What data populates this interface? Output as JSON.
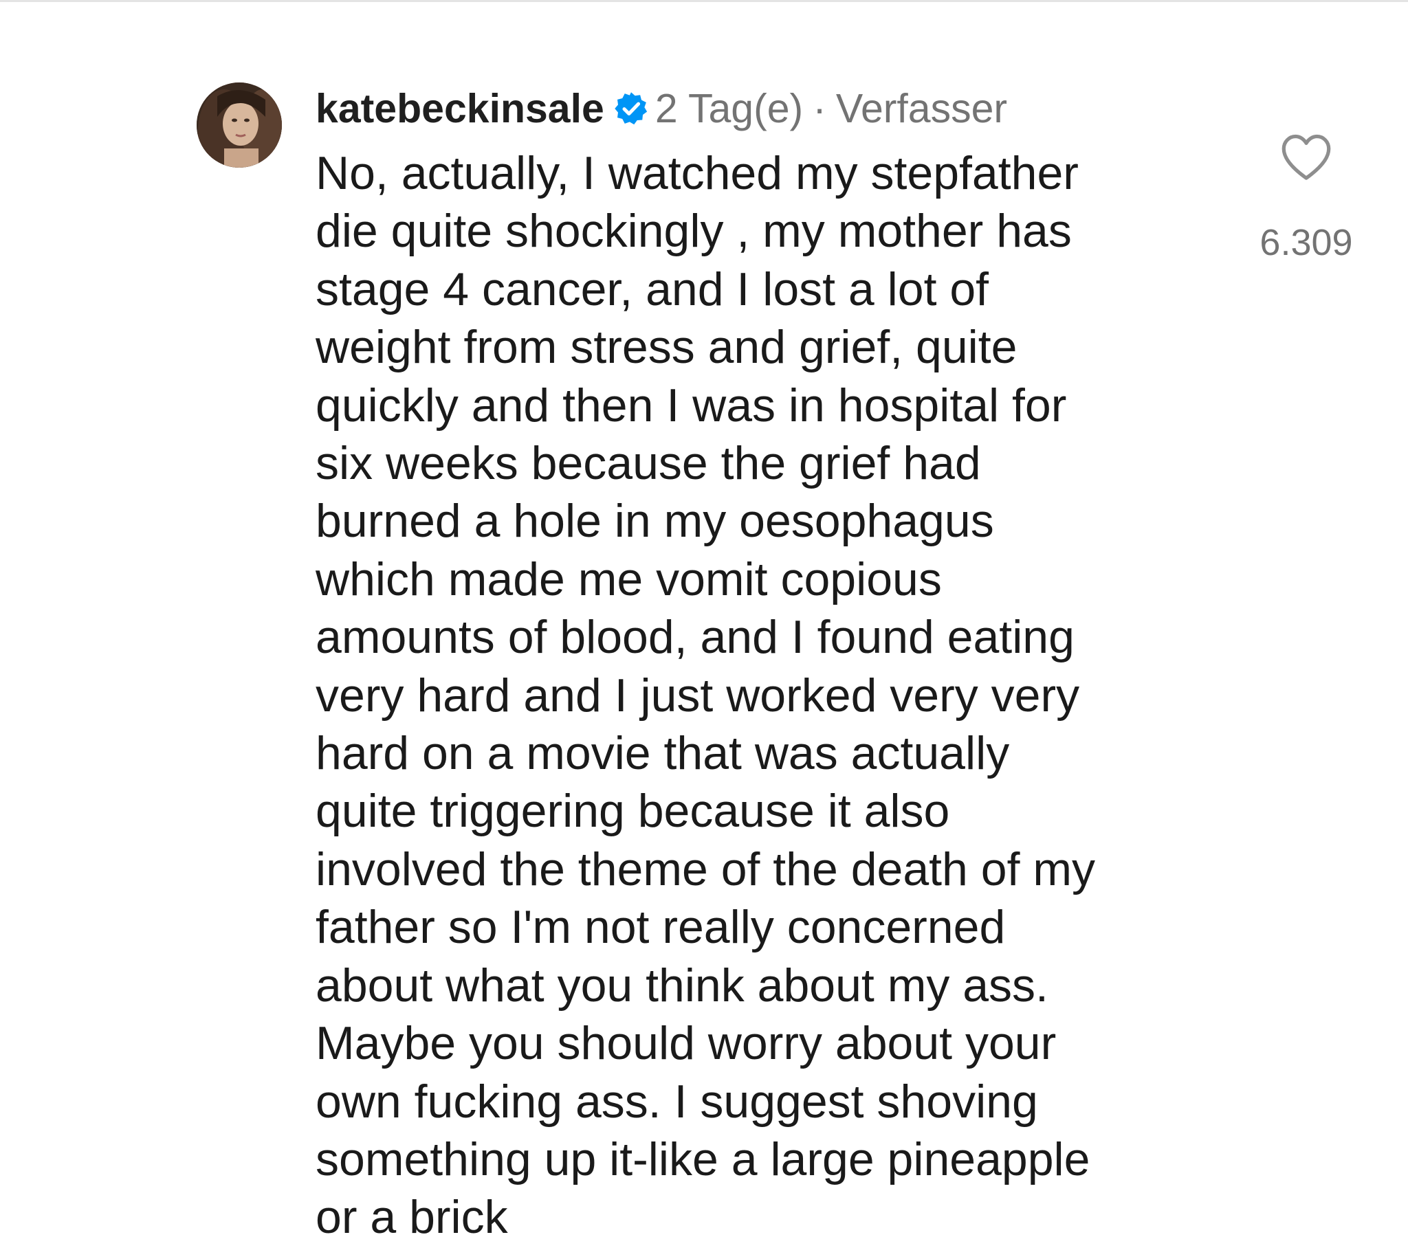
{
  "comment": {
    "username": "katebeckinsale",
    "verified": true,
    "time_ago": "2 Tag(e)",
    "separator": "·",
    "role": "Verfasser",
    "text_lines": [
      "No, actually,  I watched my stepfather",
      "die quite shockingly , my mother has",
      "stage 4 cancer, and I lost a lot of",
      "weight from stress and grief, quite",
      "quickly and then I was in hospital for",
      "six weeks because the grief had",
      "burned a hole in my oesophagus",
      "which made me vomit copious",
      "amounts of blood, and I found eating",
      "very hard and I just worked very very",
      "hard on a movie that was actually",
      "quite triggering because it also",
      "involved the theme of the death of my",
      "father so I'm not really concerned",
      "about what you think about my ass.",
      "Maybe you should worry about your",
      "own fucking ass. I suggest shoving",
      "something up it-like a large pineapple",
      "or a brick"
    ],
    "like_count": "6.309"
  },
  "icons": {
    "verified": "verified-badge-icon",
    "like": "heart-icon"
  },
  "colors": {
    "verified_blue": "#0095f6",
    "meta_gray": "#737373",
    "text": "#1a1a1a"
  }
}
